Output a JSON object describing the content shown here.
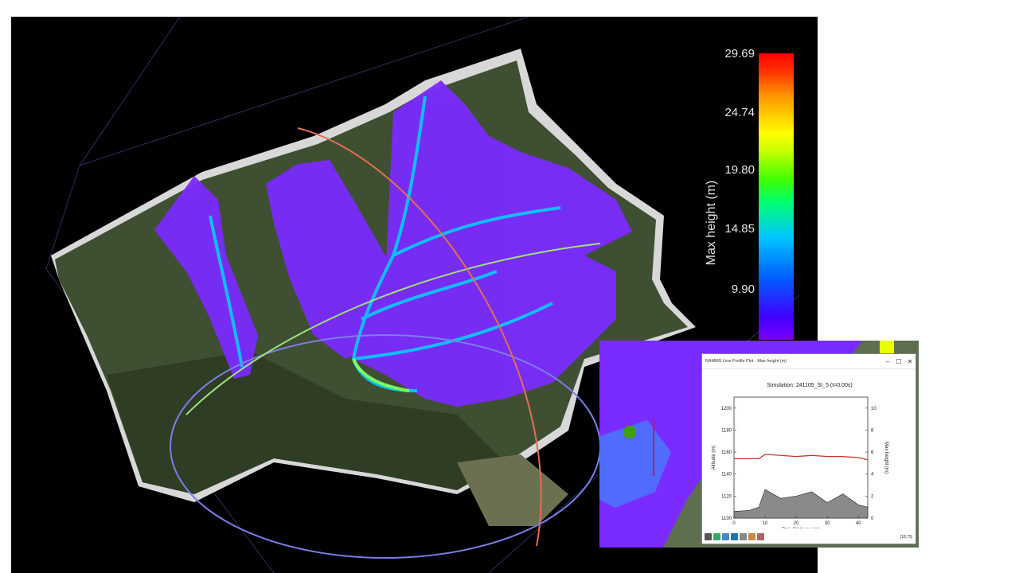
{
  "colorbar": {
    "title": "Max height (m)",
    "ticks": [
      "29.69",
      "24.74",
      "19.80",
      "14.85",
      "9.90"
    ]
  },
  "inset": {
    "window_title": "RAMMS Line Profile Plot - Max height (m)",
    "plot_title": "Simulation: 241105_SI_5  (t=0.00s)",
    "xlabel": "Proj. Distance (m)",
    "ylabel_left": "Altitude (m)",
    "ylabel_right": "Max height (m)",
    "x_ticks": [
      "0",
      "10",
      "20",
      "30",
      "40"
    ],
    "y_ticks_left": [
      "1100",
      "1120",
      "1140",
      "1160",
      "1180",
      "1200"
    ],
    "y_ticks_right": [
      "0",
      "2",
      "4",
      "6",
      "8",
      "10"
    ],
    "status": "[18,75]",
    "window_buttons": [
      "–",
      "☐",
      "✕"
    ]
  },
  "colors": {
    "background": "#000000",
    "flow": "#7a2bff",
    "terrain": "#4a5a3a",
    "altitude_line": "#c0392b",
    "height_fill": "#8a8a8a"
  },
  "chart_data": {
    "type": "line",
    "x": [
      0,
      5,
      8,
      10,
      15,
      20,
      25,
      30,
      35,
      40,
      43
    ],
    "series": [
      {
        "values": [
          1154,
          1154,
          1154,
          1158,
          1157,
          1156,
          1157,
          1156,
          1156,
          1155,
          1153
        ]
      },
      {
        "values": [
          0.6,
          0.7,
          1.0,
          2.6,
          1.8,
          2.0,
          2.4,
          1.4,
          2.2,
          1.2,
          1.0
        ]
      }
    ],
    "xlim": [
      0,
      43
    ],
    "ylim": [
      1100,
      1210
    ],
    "y2lim": [
      0,
      11
    ]
  }
}
